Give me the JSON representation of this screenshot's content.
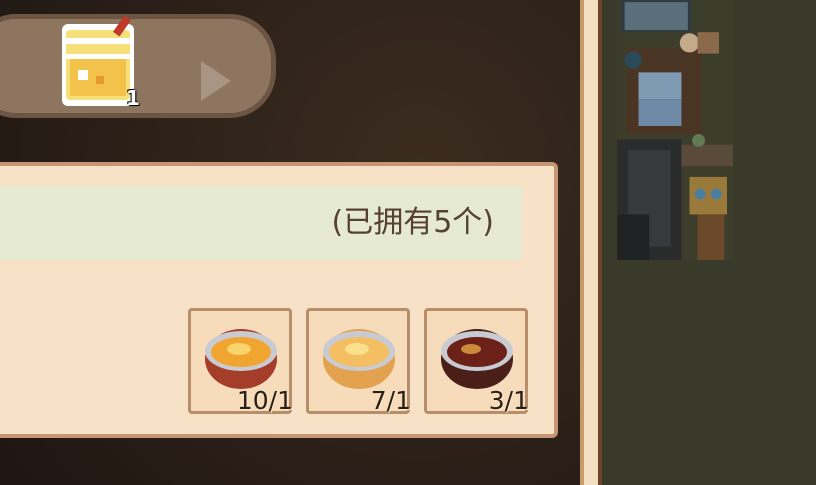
{
  "selector": {
    "item_icon": "lemonade-drink-icon",
    "item_count": "1",
    "next_icon": "arrow-right-icon"
  },
  "panel": {
    "owned_text": "(已拥有5个)",
    "ingredients": [
      {
        "icon": "orange-bowl-icon",
        "count": "10/1"
      },
      {
        "icon": "yellow-bowl-icon",
        "count": "7/1"
      },
      {
        "icon": "dark-bowl-icon",
        "count": "3/1"
      }
    ]
  },
  "colors": {
    "panel_bg": "#f7e2c7",
    "owned_bar": "#e6ead3",
    "selector_bg": "#8e7560"
  }
}
